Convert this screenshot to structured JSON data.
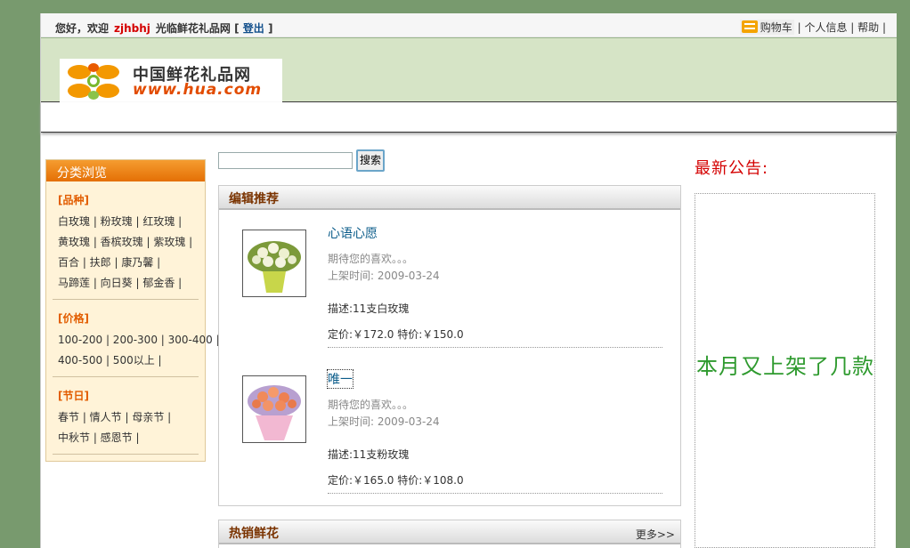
{
  "topbar": {
    "greet_prefix": "您好，欢迎",
    "username": "zjhbhj",
    "greet_suffix": "光临鲜花礼品网 [",
    "logout": "登出",
    "greet_close": "]",
    "cart": "购物车",
    "links_rest": "| 个人信息 | 帮助 |"
  },
  "logo": {
    "name": "中国鲜花礼品网",
    "url": "www.hua.com"
  },
  "category": {
    "title": "分类浏览",
    "groups": [
      {
        "title": "[品种]",
        "rows": [
          "白玫瑰 | 粉玫瑰 | 红玫瑰 |",
          "黄玫瑰 | 香槟玫瑰 | 紫玫瑰 |",
          "百合 | 扶郎 | 康乃馨 |",
          "马蹄莲 | 向日葵 | 郁金香 |"
        ]
      },
      {
        "title": "[价格]",
        "rows": [
          "100-200 | 200-300 | 300-400 |",
          "400-500 | 500以上 |"
        ]
      },
      {
        "title": "[节日]",
        "rows": [
          "春节 | 情人节 | 母亲节 |",
          "中秋节 | 感恩节 |"
        ]
      }
    ]
  },
  "search": {
    "value": "",
    "button": "搜索"
  },
  "recommend": {
    "title": "编辑推荐",
    "products": [
      {
        "name": "心语心愿",
        "desc": "期待您的喜欢。。。",
        "date": "上架时间: 2009-03-24",
        "info": "描述:11支白玫瑰",
        "price": "定价:￥172.0  特价:￥150.0"
      },
      {
        "name": "唯一",
        "desc": "期待您的喜欢。。。",
        "date": "上架时间: 2009-03-24",
        "info": "描述:11支粉玫瑰",
        "price": "定价:￥165.0  特价:￥108.0"
      }
    ]
  },
  "hot": {
    "title": "热销鲜花",
    "more": "更多>>"
  },
  "announcement": {
    "title": "最新公告:",
    "text": "本月又上架了几款"
  }
}
